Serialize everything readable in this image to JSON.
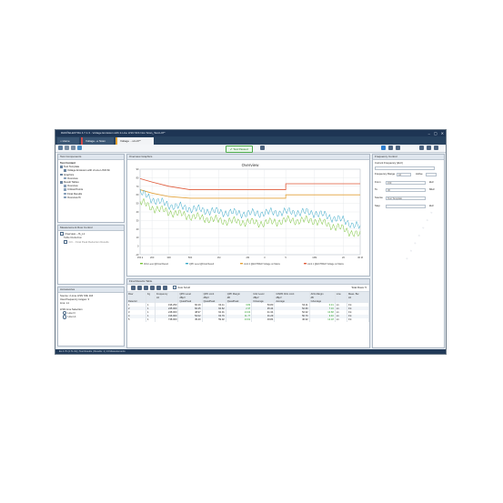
{
  "window": {
    "title": "R&S®ELEKTRA 4.7.1.3 - Voltage Emission with 2-Line LISN Shb Nov Scan_Test.L07*",
    "controls": [
      "‒",
      "▢",
      "✕"
    ]
  },
  "tabs": [
    {
      "label": "Home"
    },
    {
      "label": "Voltage...e Scan"
    },
    {
      "label": "Voltage ...st.L07*"
    }
  ],
  "toolbar": {
    "status": "Test Passed"
  },
  "test_contents": {
    "title": "Test Components",
    "heading": "Test Content",
    "items": [
      "Test Template",
      "Voltage Emission with 2-Line LISN Sh",
      "Graphics",
      "Overview",
      "Result Tables",
      "Overview",
      "Critical Points",
      "Final Results",
      "Overview fb"
    ]
  },
  "measurement_panel": {
    "title": "Measurement Row Control",
    "items": [
      "Overview – fb_L1",
      "Table Reduction",
      "Crit. - Final Peak Reduction Results"
    ]
  },
  "accessories": {
    "title": "Accessories",
    "lines": [
      "Source: 2-Line LISN Shb 116",
      "Used frequency ranges: 3",
      "Line: L1"
    ],
    "group": "LISN Line Selection",
    "options": [
      "Line N",
      "Line L1"
    ]
  },
  "overview_graphics": {
    "title": "Overview Graphics",
    "chart_title": "Overview"
  },
  "chart_data": {
    "type": "line",
    "title": "Overview",
    "x": [
      0.15,
      0.2,
      0.3,
      0.5,
      1,
      2,
      3,
      5,
      10,
      20,
      30
    ],
    "xticks": [
      "150 k",
      "200",
      "300",
      "500",
      "1M",
      "2M",
      "3",
      "5",
      "10M",
      "20",
      "30 M"
    ],
    "yticks": [
      "90",
      "80",
      "70",
      "60",
      "50",
      "40",
      "30",
      "20",
      "10",
      "0",
      "-10"
    ],
    "ylim": [
      -10,
      90
    ],
    "scale_x": "log",
    "grid": true,
    "legend_position": "bottom",
    "series": [
      {
        "name": "Limit 1 @EN 55022 Voltage on Mains",
        "color": "#e05a3a",
        "values": [
          79,
          75,
          70,
          66,
          66,
          66,
          66,
          66,
          73,
          73,
          73
        ]
      },
      {
        "name": "Limit 2 @EN 55022 Voltage on Mains",
        "color": "#e3a23a",
        "values": [
          66,
          62,
          58,
          56,
          56,
          56,
          56,
          56,
          60,
          60,
          60
        ]
      },
      {
        "name": "QPK Level @Final Result",
        "color": "#38a8c8",
        "values": [
          63,
          55,
          48,
          44,
          40,
          38,
          39,
          40,
          39,
          30,
          22
        ]
      },
      {
        "name": "AVG Level @Final Result",
        "color": "#7ac43a",
        "values": [
          52,
          45,
          40,
          35,
          30,
          28,
          27,
          30,
          30,
          20,
          12
        ]
      }
    ]
  },
  "results_table": {
    "title": "Final Results Table",
    "auto_scroll": "Auto Scroll",
    "total_rows": "Total Rows: 5",
    "headers": [
      "Row",
      "Fg",
      "Frequency",
      "QPK Level",
      "QPK Limit",
      "QPK Margin",
      "CAV Level",
      "CISPR AVG Limit",
      "AVG Margin",
      "Line",
      "Meas. Bw"
    ],
    "subheaders": [
      "",
      "",
      "Hz",
      "dBµV",
      "dBµV",
      "dB",
      "dBµV",
      "dBµV",
      "dB",
      "",
      "Hz"
    ],
    "detectors": [
      "Detector",
      "",
      "",
      "QuasiPeak",
      "QuasiPeak",
      "QuasiPeak",
      "CAverage",
      "Average",
      "CAverage",
      "",
      ""
    ],
    "rows": [
      [
        "1",
        "1",
        "196.250",
        "60.29",
        "64.11",
        "3.82",
        "53.80",
        "54.11",
        "0.31",
        "L1",
        "9 k"
      ],
      [
        "2",
        "1",
        "245.000",
        "60.25",
        "62.62",
        "2.37",
        "45.44",
        "52.60",
        "7.16",
        "L1",
        "9 k"
      ],
      [
        "3",
        "1",
        "248.000",
        "48.97",
        "62.01",
        "13.04",
        "41.34",
        "52.02",
        "10.68",
        "L1",
        "9 k"
      ],
      [
        "4",
        "1",
        "316.000",
        "52.02",
        "63.79",
        "11.77",
        "31.29",
        "50.70",
        "9.40",
        "L1",
        "9 k"
      ],
      [
        "5",
        "1",
        "748.000",
        "45.40",
        "59.02",
        "13.61",
        "33.84",
        "46.02",
        "12.18",
        "L1",
        "9 k"
      ]
    ]
  },
  "frequency_control": {
    "title": "Frequency Control",
    "subtitle": "Current Frequency (kHz)",
    "range_label": "Frequency Range",
    "range_value": "All",
    "active_label": "Active",
    "from_label": "From",
    "from_value": "150",
    "from_unit": "kHz",
    "to_label": "To",
    "to_value": "30",
    "to_unit": "MHz",
    "source_label": "Source",
    "source_value": "Test Template",
    "step_label": "Step",
    "step_unit": "kHz"
  },
  "statusbar": "EL 4.70 (4.71.01)  |  Test Results  |  Results: 1 | 13 Measurements"
}
